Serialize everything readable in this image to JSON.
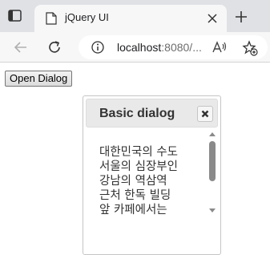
{
  "browser": {
    "tab_title": "jQuery UI",
    "url_host": "localhost",
    "url_rest": ":8080/..."
  },
  "page": {
    "open_dialog_label": "Open Dialog"
  },
  "dialog": {
    "title": "Basic dialog",
    "lines": [
      "대한민국의 수도",
      "서울의 심장부인",
      "강남의 역삼역",
      "근처 한독 빌딩",
      "앞 카페에서는"
    ]
  }
}
